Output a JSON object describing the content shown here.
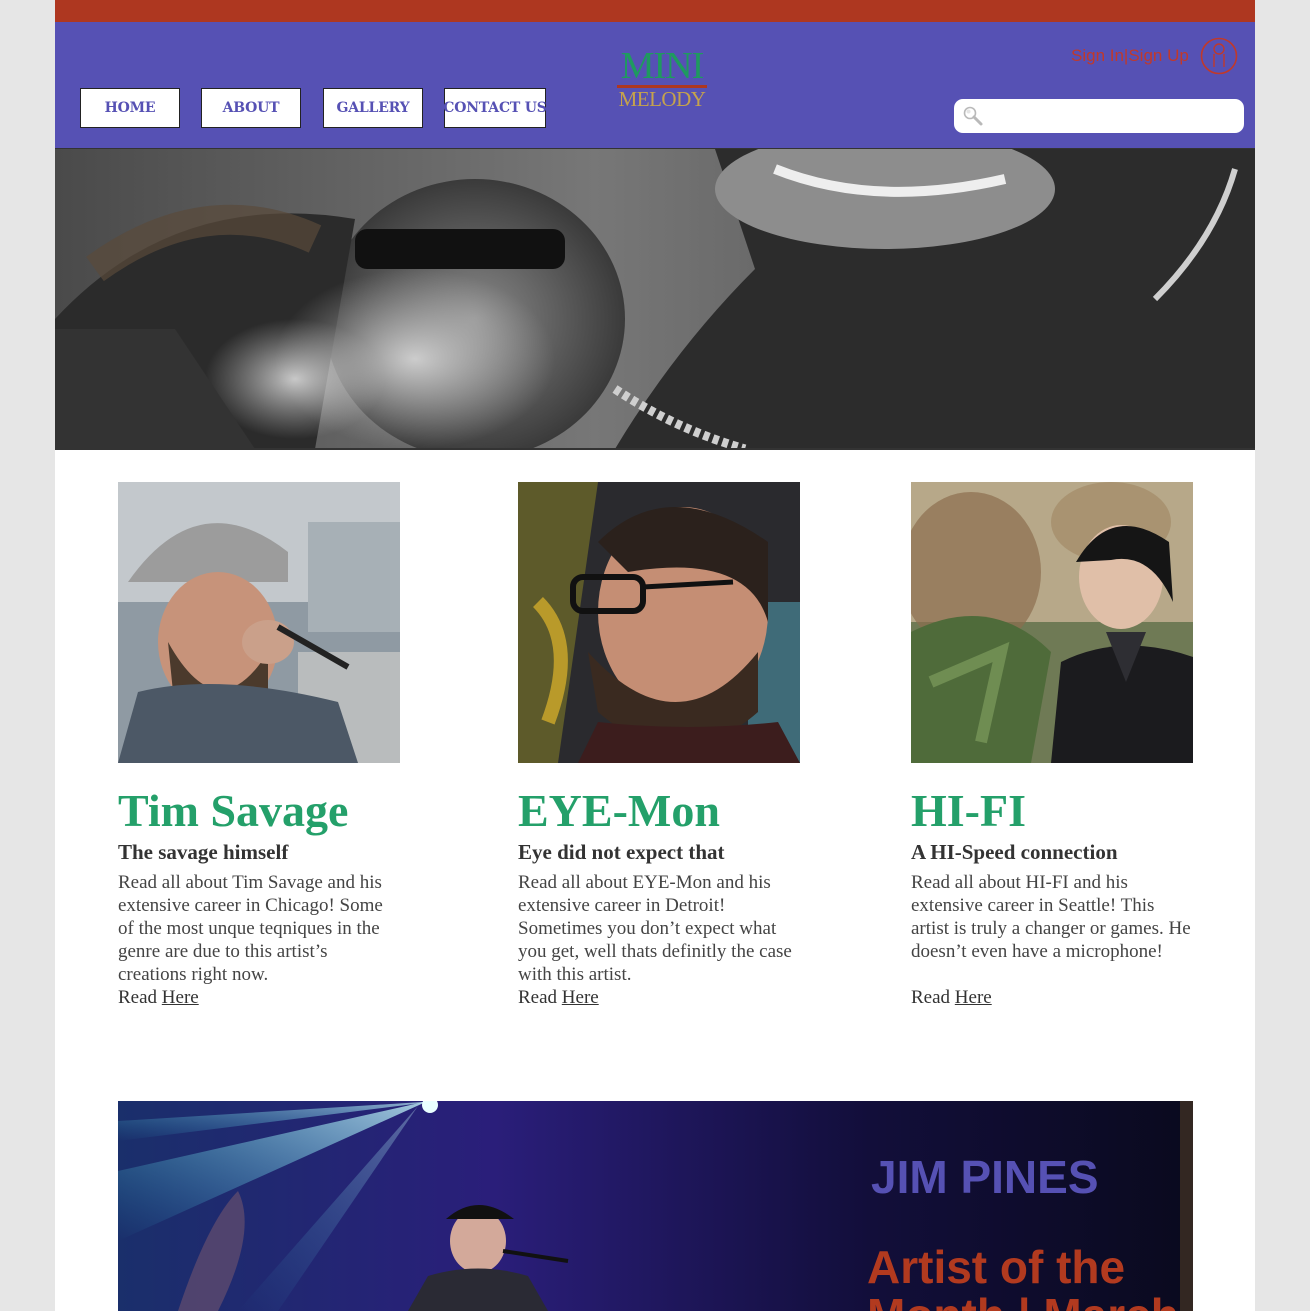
{
  "colors": {
    "accent_red": "#ae3720",
    "header_purple": "#5651b4",
    "logo_green": "#1f9a5f",
    "logo_gold": "#c5a24d",
    "name_green": "#24a06a",
    "auth_red": "#c0392b",
    "feature_red": "#b23a1f",
    "feature_purple": "#5651b4"
  },
  "header": {
    "nav": [
      {
        "label": "HOME"
      },
      {
        "label": "ABOUT"
      },
      {
        "label": "GALLERY"
      },
      {
        "label": "CONTACT US"
      }
    ],
    "logo": {
      "top": "MINI",
      "bottom": "MELODY"
    },
    "auth_link": "Sign In|Sign Up",
    "user_icon": "user-icon",
    "search": {
      "icon": "search-icon",
      "value": "",
      "placeholder": ""
    }
  },
  "hero": {
    "image": "smoking-musician-and-mural-photo"
  },
  "artists": [
    {
      "name": "Tim Savage",
      "subtitle": "The savage himself",
      "text": "Read all about Tim Savage and his extensive career in Chicago! Some of the most unque teqniques in the genre are due to this artist’s creations right now.",
      "read_prefix": "Read",
      "read_link": "Here",
      "photo": "bearded-rapper-with-cap-and-microphone"
    },
    {
      "name": "EYE-Mon",
      "subtitle": "Eye did not expect that",
      "text": "Read all about EYE-Mon and his extensive career in Detroit! Sometimes you don’t expect what you get, well thats definitly the case with this artist.",
      "read_prefix": "Read",
      "read_link": "Here",
      "photo": "man-with-glasses-profile"
    },
    {
      "name": "HI-FI",
      "subtitle": "A HI-Speed connection",
      "text": "Read all about HI-FI and his extensive career in Seattle! This artist is truly a changer or games. He doesn’t even have a microphone!",
      "read_prefix": "Read",
      "read_link": "Here",
      "photo": "young-man-in-black-jacket-outdoors"
    }
  ],
  "feature": {
    "name": "JIM PINES",
    "title": "Artist of the Month | March",
    "image": "concert-stage-with-blue-lights"
  }
}
